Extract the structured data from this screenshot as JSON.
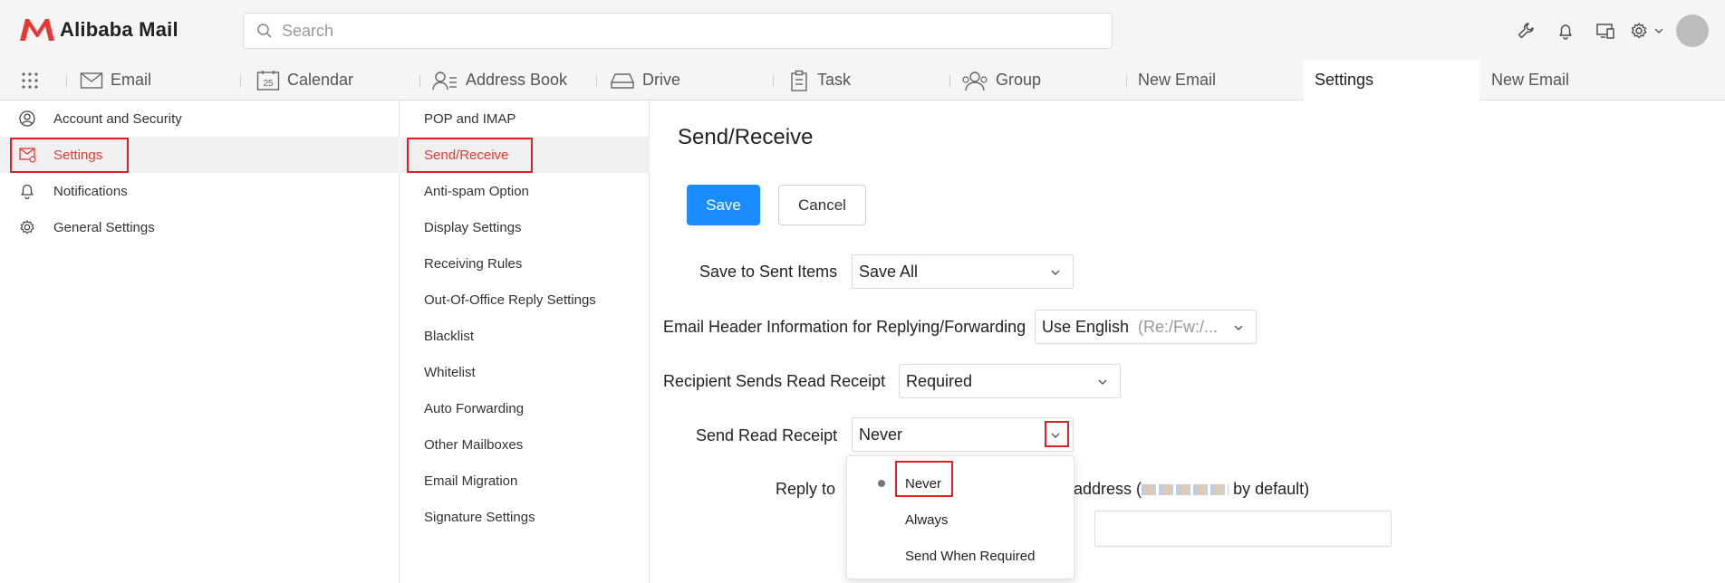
{
  "app": {
    "title": "Alibaba Mail",
    "brand_color": "#e53935",
    "accent_color": "#1a8cff"
  },
  "search": {
    "placeholder": "Search"
  },
  "top_icons": [
    "wrench-icon",
    "bell-icon",
    "device-switch-icon",
    "gear-icon",
    "chevron-down-icon",
    "avatar"
  ],
  "nav": {
    "items": [
      {
        "label": "Email",
        "icon": "envelope-icon"
      },
      {
        "label": "Calendar",
        "icon": "calendar-icon",
        "icon_text": "25"
      },
      {
        "label": "Address Book",
        "icon": "contacts-icon"
      },
      {
        "label": "Drive",
        "icon": "drive-icon"
      },
      {
        "label": "Task",
        "icon": "clipboard-icon"
      },
      {
        "label": "Group",
        "icon": "group-icon"
      },
      {
        "label": "New Email"
      },
      {
        "label": "Settings",
        "active": true
      },
      {
        "label": "New Email"
      }
    ]
  },
  "settings_menu": {
    "items": [
      {
        "label": "Account and Security",
        "icon": "user-circle-icon"
      },
      {
        "label": "Settings",
        "icon": "mail-settings-icon",
        "active": true
      },
      {
        "label": "Notifications",
        "icon": "bell-icon"
      },
      {
        "label": "General Settings",
        "icon": "gear-icon"
      }
    ]
  },
  "submenu": {
    "items": [
      "POP and IMAP",
      "Send/Receive",
      "Anti-spam Option",
      "Display Settings",
      "Receiving Rules",
      "Out-Of-Office Reply Settings",
      "Blacklist",
      "Whitelist",
      "Auto Forwarding",
      "Other Mailboxes",
      "Email Migration",
      "Signature Settings"
    ],
    "active_index": 1
  },
  "main": {
    "title": "Send/Receive",
    "save_label": "Save",
    "cancel_label": "Cancel",
    "fields": {
      "save_sent": {
        "label": "Save to Sent Items",
        "value": "Save All"
      },
      "header_info": {
        "label": "Email Header Information for Replying/Forwarding",
        "value": "Use English",
        "hint": "(Re:/Fw:/..."
      },
      "recipient_receipt": {
        "label": "Recipient Sends Read Receipt",
        "value": "Required"
      },
      "send_receipt": {
        "label": "Send Read Receipt",
        "value": "Never"
      },
      "reply_to": {
        "label": "Reply to",
        "text_before": "ng address (",
        "text_after": " by default)"
      }
    }
  },
  "dropdown": {
    "options": [
      "Never",
      "Always",
      "Send When Required"
    ],
    "selected": "Never"
  }
}
